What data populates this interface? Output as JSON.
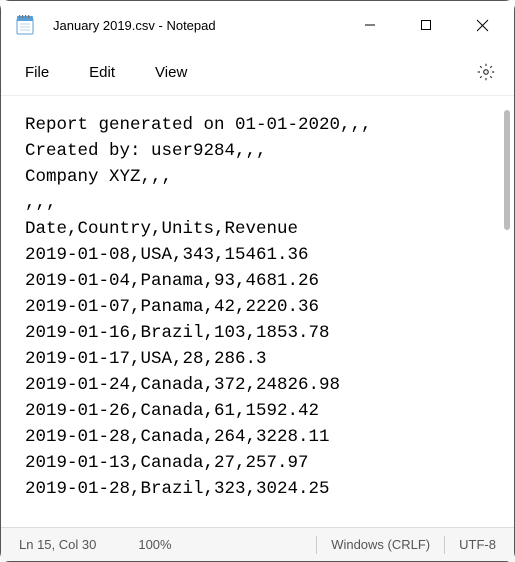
{
  "window": {
    "title": "January 2019.csv - Notepad"
  },
  "menu": {
    "file": "File",
    "edit": "Edit",
    "view": "View"
  },
  "content": {
    "lines": [
      "Report generated on 01-01-2020,,,",
      "Created by: user9284,,,",
      "Company XYZ,,,",
      ",,,",
      "Date,Country,Units,Revenue",
      "2019-01-08,USA,343,15461.36",
      "2019-01-04,Panama,93,4681.26",
      "2019-01-07,Panama,42,2220.36",
      "2019-01-16,Brazil,103,1853.78",
      "2019-01-17,USA,28,286.3",
      "2019-01-24,Canada,372,24826.98",
      "2019-01-26,Canada,61,1592.42",
      "2019-01-28,Canada,264,3228.11",
      "2019-01-13,Canada,27,257.97",
      "2019-01-28,Brazil,323,3024.25"
    ]
  },
  "status": {
    "position": "Ln 15, Col 30",
    "zoom": "100%",
    "line_ending": "Windows (CRLF)",
    "encoding": "UTF-8"
  }
}
